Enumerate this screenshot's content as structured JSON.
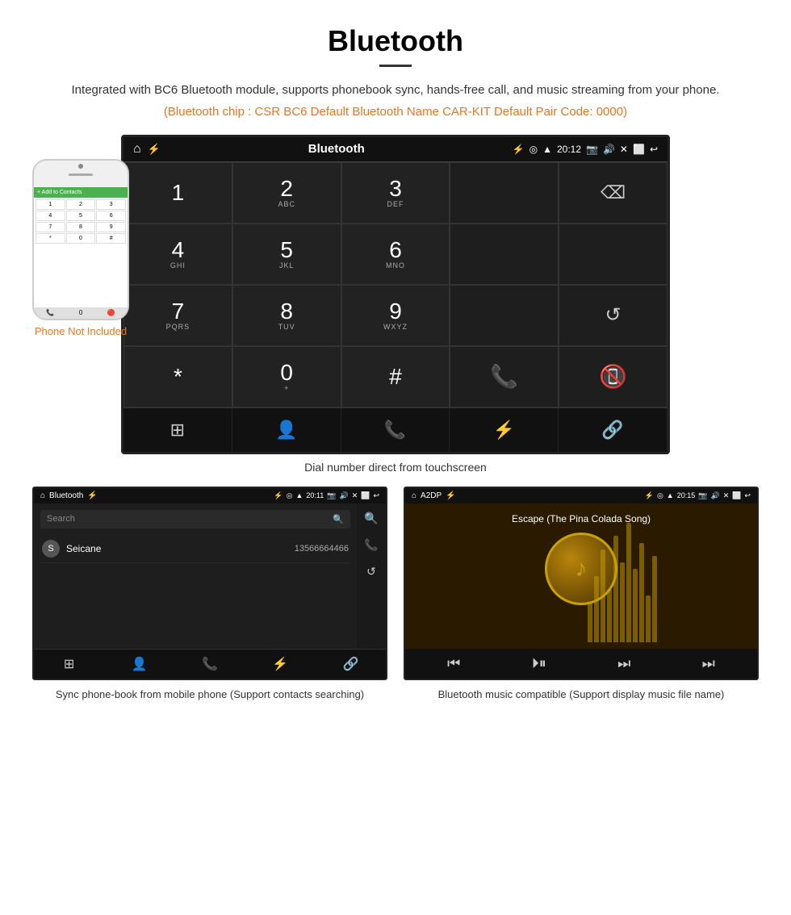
{
  "page": {
    "title": "Bluetooth",
    "description": "Integrated with BC6 Bluetooth module, supports phonebook sync, hands-free call, and music streaming from your phone.",
    "specs": "(Bluetooth chip : CSR BC6    Default Bluetooth Name CAR-KIT    Default Pair Code: 0000)",
    "phone_label": "Phone Not Included",
    "main_caption": "Dial number direct from touchscreen",
    "bottom_left_caption": "Sync phone-book from mobile phone\n(Support contacts searching)",
    "bottom_right_caption": "Bluetooth music compatible\n(Support display music file name)"
  },
  "main_screen": {
    "status": {
      "title": "Bluetooth",
      "time": "20:12",
      "usb_icon": "⚡",
      "bt_icon": "⚡",
      "location_icon": "◎",
      "signal": "▲▲",
      "camera": "📷",
      "volume": "🔊",
      "home": "⌂",
      "back": "↩"
    },
    "dialpad": [
      {
        "num": "1",
        "sub": ""
      },
      {
        "num": "2",
        "sub": "ABC"
      },
      {
        "num": "3",
        "sub": "DEF"
      },
      {
        "num": "",
        "sub": ""
      },
      {
        "num": "⌫",
        "sub": ""
      },
      {
        "num": "4",
        "sub": "GHI"
      },
      {
        "num": "5",
        "sub": "JKL"
      },
      {
        "num": "6",
        "sub": "MNO"
      },
      {
        "num": "",
        "sub": ""
      },
      {
        "num": "",
        "sub": ""
      },
      {
        "num": "7",
        "sub": "PQRS"
      },
      {
        "num": "8",
        "sub": "TUV"
      },
      {
        "num": "9",
        "sub": "WXYZ"
      },
      {
        "num": "",
        "sub": ""
      },
      {
        "num": "↺",
        "sub": ""
      },
      {
        "num": "*",
        "sub": ""
      },
      {
        "num": "0",
        "sub": "+"
      },
      {
        "num": "#",
        "sub": ""
      },
      {
        "num": "📞",
        "sub": ""
      },
      {
        "num": "📵",
        "sub": ""
      }
    ],
    "nav_icons": [
      "⊞",
      "👤",
      "📞",
      "⚡",
      "🔗"
    ]
  },
  "contacts_screen": {
    "status": {
      "left": "⌂  Bluetooth  ⚡",
      "right": "⚡ ◎ ▲ 20:11  📷 🔊 ✕ ⬜ ↩"
    },
    "search_placeholder": "Search",
    "contacts": [
      {
        "initial": "S",
        "name": "Seicane",
        "phone": "13566664466"
      }
    ],
    "nav_icons": [
      "⊞",
      "👤",
      "📞",
      "⚡",
      "🔗"
    ],
    "side_icons": [
      "🔍",
      "📞",
      "↺"
    ]
  },
  "music_screen": {
    "status": {
      "left": "⌂  A2DP  ⚡",
      "right": "⚡ ◎ ▲ 20:15  📷 🔊 ✕ ⬜ ↩"
    },
    "song_title": "Escape (The Pina Colada Song)",
    "controls": [
      "⏮",
      "⏭",
      "⏵⏸",
      "⏭⏭"
    ]
  }
}
